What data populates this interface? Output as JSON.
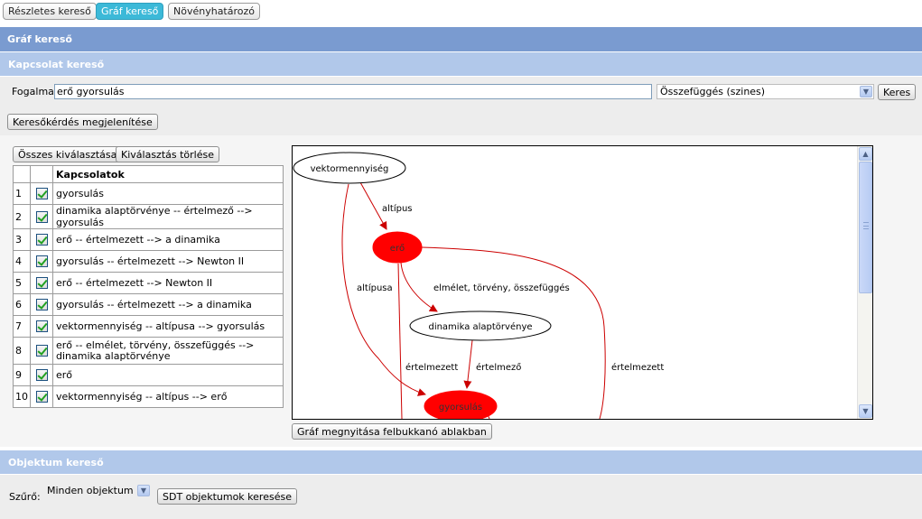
{
  "tabs": [
    {
      "label": "Részletes kereső",
      "active": false
    },
    {
      "label": "Gráf kereső",
      "active": true
    },
    {
      "label": "Növényhatározó",
      "active": false
    }
  ],
  "graf_panel": {
    "title": "Gráf kereső"
  },
  "kapcsolat_panel": {
    "title": "Kapcsolat kereső",
    "fogalmak_label": "Fogalmak",
    "fogalmak_value": "erő gyorsulás",
    "relation_select": "Összefüggés (szines)",
    "search_button": "Keres",
    "show_query_button": "Keresőkérdés megjelenítése",
    "select_all_button": "Összes kiválasztása",
    "clear_selection_button": "Kiválasztás törlése",
    "open_popup_button": "Gráf megnyitása felbukkanó ablakban"
  },
  "relations_table": {
    "header": "Kapcsolatok",
    "rows": [
      {
        "n": "1",
        "checked": true,
        "text": "gyorsulás"
      },
      {
        "n": "2",
        "checked": true,
        "text": "dinamika alaptörvénye -- értelmező --> gyorsulás"
      },
      {
        "n": "3",
        "checked": true,
        "text": "erő -- értelmezett --> a dinamika"
      },
      {
        "n": "4",
        "checked": true,
        "text": "gyorsulás -- értelmezett --> Newton II"
      },
      {
        "n": "5",
        "checked": true,
        "text": "erő -- értelmezett --> Newton II"
      },
      {
        "n": "6",
        "checked": true,
        "text": "gyorsulás -- értelmezett --> a dinamika"
      },
      {
        "n": "7",
        "checked": true,
        "text": "vektormennyiség -- altípusa --> gyorsulás"
      },
      {
        "n": "8",
        "checked": true,
        "text": "erő -- elmélet, törvény, összefüggés --> dinamika alaptörvénye"
      },
      {
        "n": "9",
        "checked": true,
        "text": "erő"
      },
      {
        "n": "10",
        "checked": true,
        "text": "vektormennyiség -- altípus --> erő"
      }
    ]
  },
  "graph": {
    "nodes": {
      "vektormennyiseg": "vektormennyiség",
      "ero": "erő",
      "dinamika": "dinamika alaptörvénye",
      "gyorsulas": "gyorsulás"
    },
    "edges": {
      "altipus": "altípus",
      "altipusa": "altípusa",
      "elmelet": "elmélet, törvény, összefüggés",
      "ertelmezett_1": "értelmezett",
      "ertelmezo": "értelmező",
      "ertelmezett_2": "értelmezett"
    },
    "colors": {
      "highlight": "#ff0000",
      "edge": "#cc0000"
    }
  },
  "objektum_panel": {
    "title": "Objektum kereső",
    "filter_label": "Szűrő:",
    "filter_value": "Minden objektum",
    "search_button": "SDT objektumok keresése"
  }
}
